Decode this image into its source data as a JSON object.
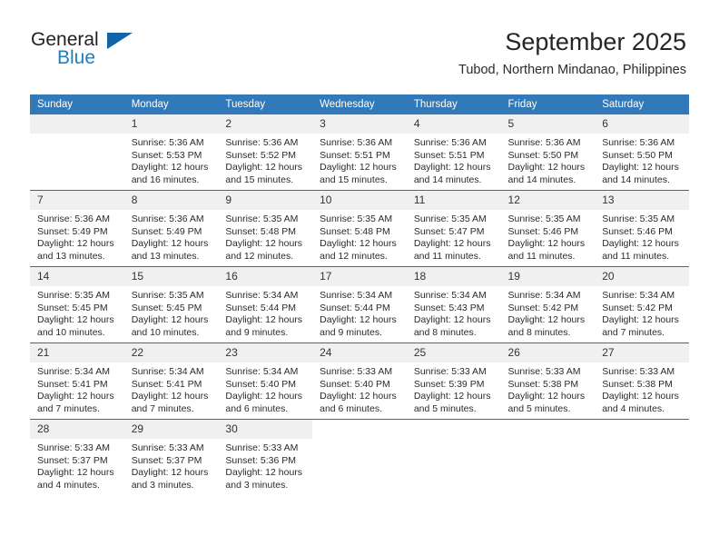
{
  "brand": {
    "name_part1": "General",
    "name_part2": "Blue",
    "triangle_icon": "triangle-icon",
    "accent_blue": "#1164a8",
    "light_blue": "#1b7fc4"
  },
  "header": {
    "title": "September 2025",
    "subtitle": "Tubod, Northern Mindanao, Philippines",
    "header_bg": "#3179b8",
    "daynum_bg": "#f0f0f0",
    "separator": "#2f6fa8"
  },
  "weekdays": [
    "Sunday",
    "Monday",
    "Tuesday",
    "Wednesday",
    "Thursday",
    "Friday",
    "Saturday"
  ],
  "labels": {
    "sunrise_prefix": "Sunrise:",
    "sunset_prefix": "Sunset:",
    "daylight_prefix": "Daylight:"
  },
  "weeks": [
    [
      {
        "blank": true
      },
      {
        "day": "1",
        "sunrise": "Sunrise: 5:36 AM",
        "sunset": "Sunset: 5:53 PM",
        "daylight1": "Daylight: 12 hours",
        "daylight2": "and 16 minutes."
      },
      {
        "day": "2",
        "sunrise": "Sunrise: 5:36 AM",
        "sunset": "Sunset: 5:52 PM",
        "daylight1": "Daylight: 12 hours",
        "daylight2": "and 15 minutes."
      },
      {
        "day": "3",
        "sunrise": "Sunrise: 5:36 AM",
        "sunset": "Sunset: 5:51 PM",
        "daylight1": "Daylight: 12 hours",
        "daylight2": "and 15 minutes."
      },
      {
        "day": "4",
        "sunrise": "Sunrise: 5:36 AM",
        "sunset": "Sunset: 5:51 PM",
        "daylight1": "Daylight: 12 hours",
        "daylight2": "and 14 minutes."
      },
      {
        "day": "5",
        "sunrise": "Sunrise: 5:36 AM",
        "sunset": "Sunset: 5:50 PM",
        "daylight1": "Daylight: 12 hours",
        "daylight2": "and 14 minutes."
      },
      {
        "day": "6",
        "sunrise": "Sunrise: 5:36 AM",
        "sunset": "Sunset: 5:50 PM",
        "daylight1": "Daylight: 12 hours",
        "daylight2": "and 14 minutes."
      }
    ],
    [
      {
        "day": "7",
        "sunrise": "Sunrise: 5:36 AM",
        "sunset": "Sunset: 5:49 PM",
        "daylight1": "Daylight: 12 hours",
        "daylight2": "and 13 minutes."
      },
      {
        "day": "8",
        "sunrise": "Sunrise: 5:36 AM",
        "sunset": "Sunset: 5:49 PM",
        "daylight1": "Daylight: 12 hours",
        "daylight2": "and 13 minutes."
      },
      {
        "day": "9",
        "sunrise": "Sunrise: 5:35 AM",
        "sunset": "Sunset: 5:48 PM",
        "daylight1": "Daylight: 12 hours",
        "daylight2": "and 12 minutes."
      },
      {
        "day": "10",
        "sunrise": "Sunrise: 5:35 AM",
        "sunset": "Sunset: 5:48 PM",
        "daylight1": "Daylight: 12 hours",
        "daylight2": "and 12 minutes."
      },
      {
        "day": "11",
        "sunrise": "Sunrise: 5:35 AM",
        "sunset": "Sunset: 5:47 PM",
        "daylight1": "Daylight: 12 hours",
        "daylight2": "and 11 minutes."
      },
      {
        "day": "12",
        "sunrise": "Sunrise: 5:35 AM",
        "sunset": "Sunset: 5:46 PM",
        "daylight1": "Daylight: 12 hours",
        "daylight2": "and 11 minutes."
      },
      {
        "day": "13",
        "sunrise": "Sunrise: 5:35 AM",
        "sunset": "Sunset: 5:46 PM",
        "daylight1": "Daylight: 12 hours",
        "daylight2": "and 11 minutes."
      }
    ],
    [
      {
        "day": "14",
        "sunrise": "Sunrise: 5:35 AM",
        "sunset": "Sunset: 5:45 PM",
        "daylight1": "Daylight: 12 hours",
        "daylight2": "and 10 minutes."
      },
      {
        "day": "15",
        "sunrise": "Sunrise: 5:35 AM",
        "sunset": "Sunset: 5:45 PM",
        "daylight1": "Daylight: 12 hours",
        "daylight2": "and 10 minutes."
      },
      {
        "day": "16",
        "sunrise": "Sunrise: 5:34 AM",
        "sunset": "Sunset: 5:44 PM",
        "daylight1": "Daylight: 12 hours",
        "daylight2": "and 9 minutes."
      },
      {
        "day": "17",
        "sunrise": "Sunrise: 5:34 AM",
        "sunset": "Sunset: 5:44 PM",
        "daylight1": "Daylight: 12 hours",
        "daylight2": "and 9 minutes."
      },
      {
        "day": "18",
        "sunrise": "Sunrise: 5:34 AM",
        "sunset": "Sunset: 5:43 PM",
        "daylight1": "Daylight: 12 hours",
        "daylight2": "and 8 minutes."
      },
      {
        "day": "19",
        "sunrise": "Sunrise: 5:34 AM",
        "sunset": "Sunset: 5:42 PM",
        "daylight1": "Daylight: 12 hours",
        "daylight2": "and 8 minutes."
      },
      {
        "day": "20",
        "sunrise": "Sunrise: 5:34 AM",
        "sunset": "Sunset: 5:42 PM",
        "daylight1": "Daylight: 12 hours",
        "daylight2": "and 7 minutes."
      }
    ],
    [
      {
        "day": "21",
        "sunrise": "Sunrise: 5:34 AM",
        "sunset": "Sunset: 5:41 PM",
        "daylight1": "Daylight: 12 hours",
        "daylight2": "and 7 minutes."
      },
      {
        "day": "22",
        "sunrise": "Sunrise: 5:34 AM",
        "sunset": "Sunset: 5:41 PM",
        "daylight1": "Daylight: 12 hours",
        "daylight2": "and 7 minutes."
      },
      {
        "day": "23",
        "sunrise": "Sunrise: 5:34 AM",
        "sunset": "Sunset: 5:40 PM",
        "daylight1": "Daylight: 12 hours",
        "daylight2": "and 6 minutes."
      },
      {
        "day": "24",
        "sunrise": "Sunrise: 5:33 AM",
        "sunset": "Sunset: 5:40 PM",
        "daylight1": "Daylight: 12 hours",
        "daylight2": "and 6 minutes."
      },
      {
        "day": "25",
        "sunrise": "Sunrise: 5:33 AM",
        "sunset": "Sunset: 5:39 PM",
        "daylight1": "Daylight: 12 hours",
        "daylight2": "and 5 minutes."
      },
      {
        "day": "26",
        "sunrise": "Sunrise: 5:33 AM",
        "sunset": "Sunset: 5:38 PM",
        "daylight1": "Daylight: 12 hours",
        "daylight2": "and 5 minutes."
      },
      {
        "day": "27",
        "sunrise": "Sunrise: 5:33 AM",
        "sunset": "Sunset: 5:38 PM",
        "daylight1": "Daylight: 12 hours",
        "daylight2": "and 4 minutes."
      }
    ],
    [
      {
        "day": "28",
        "sunrise": "Sunrise: 5:33 AM",
        "sunset": "Sunset: 5:37 PM",
        "daylight1": "Daylight: 12 hours",
        "daylight2": "and 4 minutes."
      },
      {
        "day": "29",
        "sunrise": "Sunrise: 5:33 AM",
        "sunset": "Sunset: 5:37 PM",
        "daylight1": "Daylight: 12 hours",
        "daylight2": "and 3 minutes."
      },
      {
        "day": "30",
        "sunrise": "Sunrise: 5:33 AM",
        "sunset": "Sunset: 5:36 PM",
        "daylight1": "Daylight: 12 hours",
        "daylight2": "and 3 minutes."
      },
      {
        "empty": true
      },
      {
        "empty": true
      },
      {
        "empty": true
      },
      {
        "empty": true
      }
    ]
  ]
}
